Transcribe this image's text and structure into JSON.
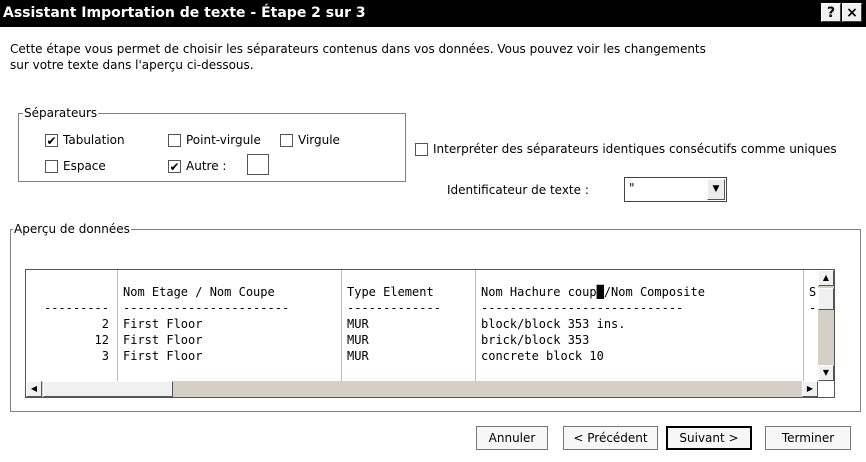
{
  "window": {
    "title": "Assistant Importation de texte - Étape 2 sur 3",
    "help_label": "?",
    "close_label": "×"
  },
  "description": "Cette étape vous permet de choisir les séparateurs contenus dans vos données. Vous pouvez voir les changements sur votre texte dans l'aperçu ci-dessous.",
  "separators": {
    "legend": "Séparateurs",
    "tab": {
      "label": "Tabulation",
      "checked": true
    },
    "semicolon": {
      "label": "Point-virgule",
      "checked": false
    },
    "comma": {
      "label": "Virgule",
      "checked": false
    },
    "space": {
      "label": "Espace",
      "checked": false
    },
    "other": {
      "label": "Autre :",
      "checked": true,
      "value": ""
    }
  },
  "consecutive": {
    "label": "Interpréter des séparateurs identiques consécutifs comme uniques",
    "checked": false
  },
  "text_qualifier": {
    "label": "Identificateur de texte :",
    "value": "\""
  },
  "preview": {
    "legend": "Aperçu de données",
    "columns": [
      {
        "header": "",
        "underline": "---------",
        "align": "right",
        "values": [
          "2",
          "12",
          "3"
        ]
      },
      {
        "header": "Nom Etage / Nom Coupe",
        "underline": "-----------------------",
        "align": "left",
        "values": [
          "First Floor",
          "First Floor",
          "First Floor"
        ]
      },
      {
        "header": "Type Element",
        "underline": "-------------",
        "align": "left",
        "values": [
          "MUR",
          "MUR",
          "MUR"
        ]
      },
      {
        "header": "Nom Hachure coup█/Nom Composite",
        "underline": "----------------------------",
        "align": "left",
        "values": [
          "block/block 353 ins.",
          "brick/block 353",
          "concrete block 10"
        ]
      },
      {
        "header": "S",
        "underline": "--",
        "align": "left",
        "values": [
          "",
          "",
          ""
        ]
      }
    ]
  },
  "buttons": {
    "cancel": "Annuler",
    "previous": "< Précédent",
    "next": "Suivant >",
    "finish": "Terminer"
  }
}
